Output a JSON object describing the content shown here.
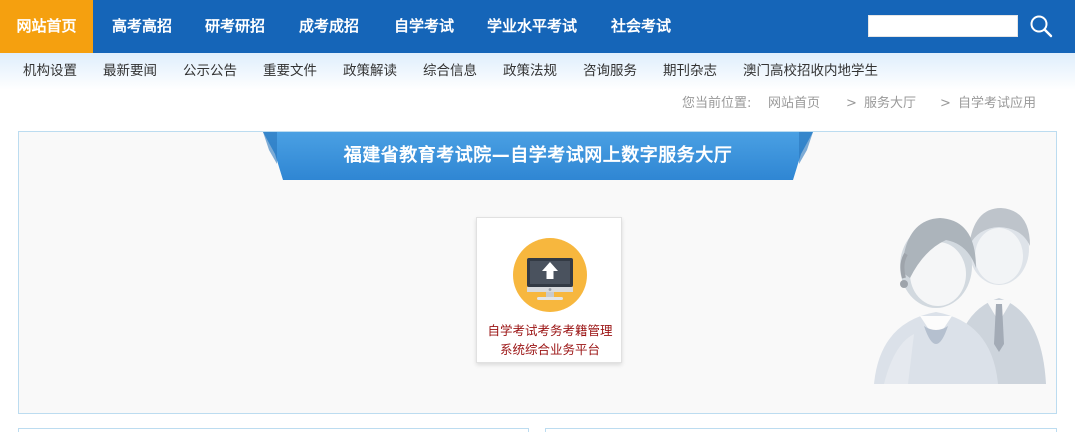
{
  "top_nav": {
    "items": [
      {
        "label": "网站首页"
      },
      {
        "label": "高考高招"
      },
      {
        "label": "研考研招"
      },
      {
        "label": "成考成招"
      },
      {
        "label": "自学考试"
      },
      {
        "label": "学业水平考试"
      },
      {
        "label": "社会考试"
      }
    ],
    "search": {
      "value": ""
    },
    "active_color": "#f5a00f",
    "bar_color": "#1565b8"
  },
  "sub_nav": {
    "items": [
      {
        "label": "机构设置"
      },
      {
        "label": "最新要闻"
      },
      {
        "label": "公示公告"
      },
      {
        "label": "重要文件"
      },
      {
        "label": "政策解读"
      },
      {
        "label": "综合信息"
      },
      {
        "label": "政策法规"
      },
      {
        "label": "咨询服务"
      },
      {
        "label": "期刊杂志"
      },
      {
        "label": "澳门高校招收内地学生"
      }
    ]
  },
  "breadcrumb": {
    "prefix": "您当前位置:",
    "items": [
      "网站首页",
      "服务大厅",
      "自学考试应用"
    ],
    "separator": ">"
  },
  "hall": {
    "title": "福建省教育考试院—自学考试网上数字服务大厅",
    "banner_color": "#3d93db",
    "service": {
      "label_line1": "自学考试考务考籍管理",
      "label_line2": "系统综合业务平台",
      "icon": "computer-upload-icon",
      "icon_color": "#f7b73e"
    },
    "mascot": "customer-service-mascot"
  }
}
